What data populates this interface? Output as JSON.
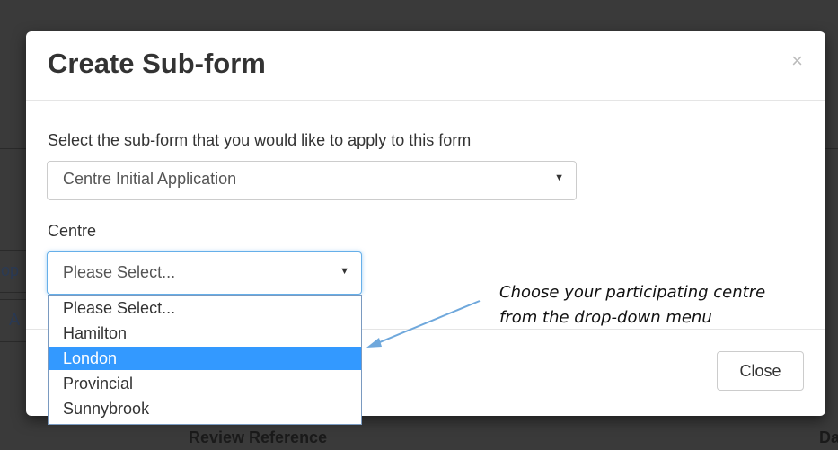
{
  "background": {
    "left_fragment_1": "op",
    "left_fragment_2": "A",
    "bottom_heading": "Review Reference",
    "right_fragment": "Da"
  },
  "modal": {
    "title": "Create Sub-form",
    "close_symbol": "×",
    "subform_label": "Select the sub-form that you would like to apply to this form",
    "subform_value": "Centre Initial Application",
    "centre_label": "Centre",
    "centre_value": "Please Select...",
    "centre_options": [
      "Please Select...",
      "Hamilton",
      "London",
      "Provincial",
      "Sunnybrook"
    ],
    "centre_highlighted": "London",
    "close_button": "Close"
  },
  "annotation": {
    "line1": "Choose your participating centre",
    "line2": "from the drop-down menu",
    "arrow_color": "#6fa8dc"
  },
  "colors": {
    "highlight": "#3399ff",
    "focus_border": "#66afe9"
  }
}
